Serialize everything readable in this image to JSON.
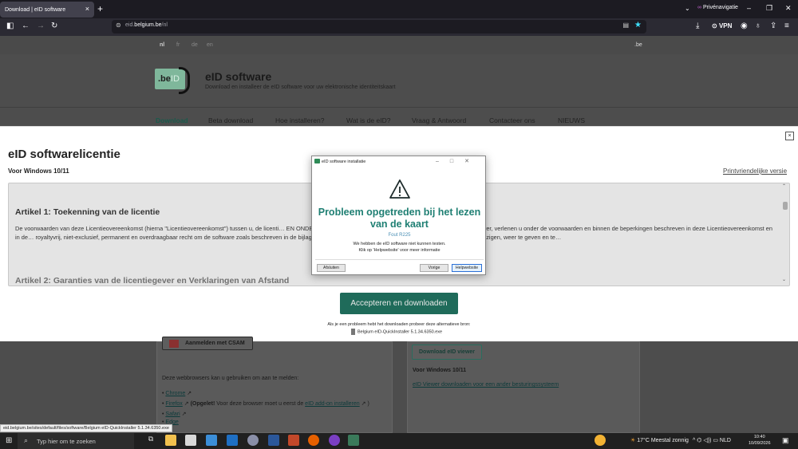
{
  "browser": {
    "tab_title": "Download | eID software",
    "tab_close": "×",
    "new_tab": "+",
    "private_label": "Privénavigatie",
    "url_prefix": "eid.",
    "url_domain": "belgium.be",
    "url_path": "/nl",
    "vpn_label": "VPN",
    "window_controls": [
      "–",
      "❐",
      "✕"
    ]
  },
  "site": {
    "languages": [
      "nl",
      "fr",
      "de",
      "en"
    ],
    "be_label": ".be",
    "logo_text": ".be",
    "logo_id": "ID",
    "title": "eID software",
    "subtitle": "Download en installeer de eID software voor uw elektronische identiteitskaart",
    "nav": [
      "Download",
      "Beta download",
      "Hoe installeren?",
      "Wat is de eID?",
      "Vraag & Antwoord",
      "Contacteer ons",
      "NIEUWS"
    ]
  },
  "license": {
    "close": "×",
    "title": "eID softwarelicentie",
    "subtitle": "Voor Windows 10/11",
    "print_link": "Printvriendelijke versie",
    "article1_title": "Artikel 1: Toekenning van de licentie",
    "article1_text": "De voorwaarden van deze Licentieovereenkomst (hierna \"Licentieovereenkomst\") tussen u, de licenti… EN ONDERSTEUNING – DG DIGITALE TRANSFORMATIE\"), de licentiegever, verlenen u onder de voorwaarden en binnen de beperkingen beschreven in deze Licentieovereenkomst en in de… royaltyvrij, niet-exclusief, permanent en overdraagbaar recht om de software zoals beschreven in de bijlage (\"eID software\") te gebruiken, te reproduceren, te kopiëren, te wijzigen, weer te geven en te…",
    "article2_title": "Artikel 2: Garanties van de licentiegever en Verklaringen van Afstand",
    "accept_button": "Accepteren en downloaden",
    "alt_text": "Als je een probleem hebt het downloaden probeer deze alternatieve bron:",
    "alt_file": "Belgium eID-QuickInstaller 5.1.34.6350.exe"
  },
  "lower": {
    "csam_button": "Aanmelden met CSAM",
    "browsers_text": "Deze webbrowsers kan u gebruiken om aan te melden:",
    "browsers": [
      "Chrome",
      "Firefox",
      "Safari",
      "Edge"
    ],
    "firefox_note_bold": "(Opgelet!",
    "firefox_note": " Voor deze browser moet u eerst de ",
    "firefox_link": "eID add-on installeren",
    "firefox_close": " )",
    "viewer_button": "Download eID viewer",
    "viewer_os": "Voor Windows 10/11",
    "viewer_link": "eID Viewer downloaden voor een ander besturingssysteem",
    "status_url": "eid.belgium.be/sites/default/files/software/Belgium eID-QuickInstaller 5.1.34.6350.exe"
  },
  "dialog": {
    "title": "eID software installatie",
    "heading": "Probleem opgetreden bij het lezen van de kaart",
    "code": "Fout R225",
    "msg1": "We hebben de eID software niet kunnen testen.",
    "msg2": "Klik op 'Helpwebsite' voor meer informatie",
    "btn_close": "Afsluiten",
    "btn_prev": "Vorige",
    "btn_help": "Helpwebsite"
  },
  "taskbar": {
    "search_placeholder": "Typ hier om te zoeken",
    "weather": "17°C  Meestal zonnig",
    "language": "NLD",
    "time": "10:40",
    "date": "10/09/2026"
  },
  "colors": {
    "accent": "#1f6b5a",
    "dialog_heading": "#1f7f73",
    "logo_green": "#7fb79b"
  }
}
